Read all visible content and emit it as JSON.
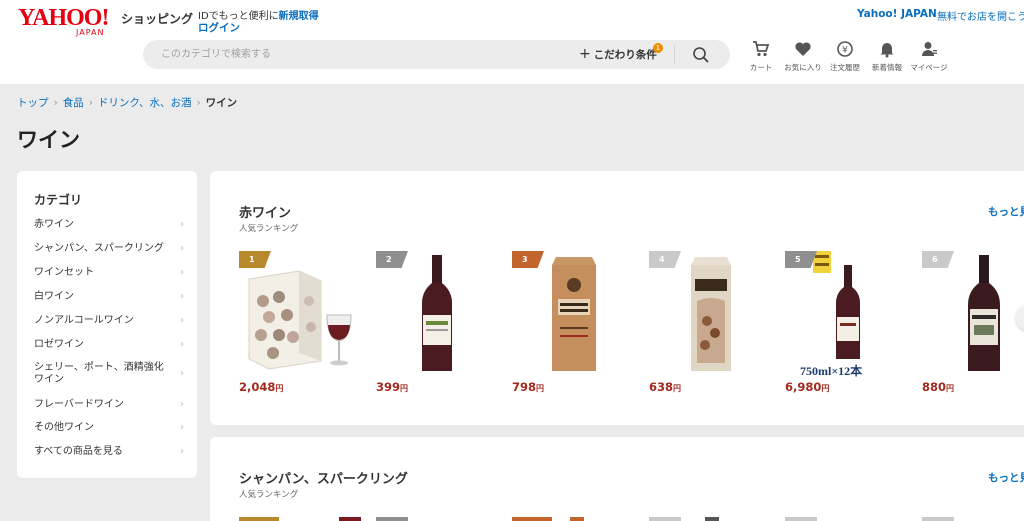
{
  "header": {
    "logo_main": "YAHOO!",
    "logo_sub": "JAPAN",
    "shop_title": "ショッピング",
    "id_prefix": "IDでもっと便利に",
    "id_register": "新規取得",
    "login": "ログイン",
    "yahoo_japan_link": "Yahoo! JAPAN",
    "open_store": "無料でお店を開こう",
    "search_placeholder": "このカテゴリで検索する",
    "kodawari": "こだわり条件",
    "kodawari_badge": "1",
    "nav": [
      {
        "label": "カート",
        "icon": "cart-icon"
      },
      {
        "label": "お気に入り",
        "icon": "heart-icon"
      },
      {
        "label": "注文履歴",
        "icon": "order-history-icon"
      },
      {
        "label": "新着情報",
        "icon": "bell-icon"
      },
      {
        "label": "マイページ",
        "icon": "user-icon"
      }
    ]
  },
  "breadcrumb": [
    "トップ",
    "食品",
    "ドリンク、水、お酒",
    "ワイン"
  ],
  "page_title": "ワイン",
  "sidebar": {
    "title": "カテゴリ",
    "items": [
      "赤ワイン",
      "シャンパン、スパークリング",
      "ワインセット",
      "白ワイン",
      "ノンアルコールワイン",
      "ロゼワイン",
      "シェリー、ポート、酒精強化ワイン",
      "フレーバードワイン",
      "その他ワイン",
      "すべての商品を見る"
    ]
  },
  "sections": [
    {
      "title": "赤ワイン",
      "subtitle": "人気ランキング",
      "more": "もっと見る",
      "products": [
        {
          "rank": "1",
          "price": "2,048",
          "unit": "円",
          "image": "box-wine-image"
        },
        {
          "rank": "2",
          "price": "399",
          "unit": "円",
          "image": "red-wine-bottle-image"
        },
        {
          "rank": "3",
          "price": "798",
          "unit": "円",
          "image": "wine-carton-image"
        },
        {
          "rank": "4",
          "price": "638",
          "unit": "円",
          "image": "arturo-wine-carton-image"
        },
        {
          "rank": "5",
          "price": "6,980",
          "unit": "円",
          "image": "wine-bottle-set-image",
          "caption": "750ml×12本"
        },
        {
          "rank": "6",
          "price": "880",
          "unit": "円",
          "image": "redwood-wine-bottle-image"
        }
      ]
    },
    {
      "title": "シャンパン、スパークリング",
      "subtitle": "人気ランキング",
      "more": "もっと見る"
    }
  ],
  "colors": {
    "brand_red": "#e60012",
    "link_blue": "#0a6ebd",
    "price_red": "#a22a1f",
    "rank_gold": "#b8892c",
    "rank_silver": "#8f8f8f",
    "rank_bronze": "#c2652c",
    "rank_gray": "#c9c9c9"
  }
}
